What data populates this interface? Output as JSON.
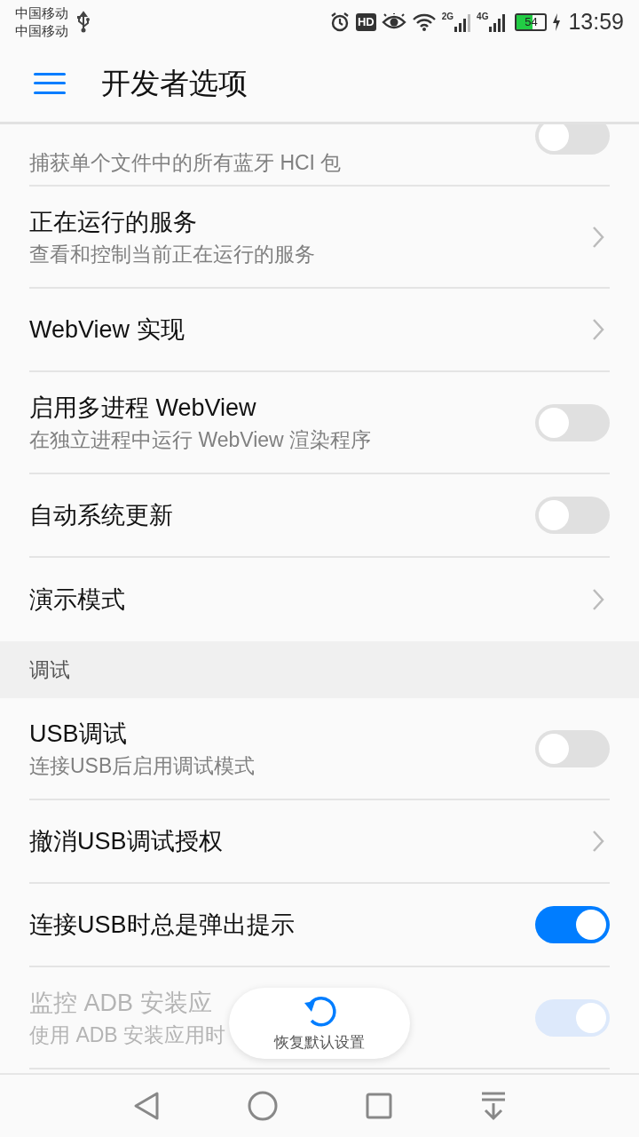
{
  "status_bar": {
    "carriers": [
      "中国移动",
      "中国移动"
    ],
    "hd": "HD",
    "network_2g": "2G",
    "network_4g": "4G",
    "battery": "54",
    "time": "13:59"
  },
  "header": {
    "title": "开发者选项"
  },
  "sections": [
    {
      "items": [
        {
          "kind": "toggle",
          "subtitle": "捕获单个文件中的所有蓝牙 HCI 包",
          "on": false,
          "disabled": false,
          "cut": true
        },
        {
          "kind": "link",
          "title": "正在运行的服务",
          "subtitle": "查看和控制当前正在运行的服务",
          "disabled": false
        },
        {
          "kind": "link",
          "title": "WebView 实现",
          "disabled": false
        },
        {
          "kind": "toggle",
          "title": "启用多进程 WebView",
          "subtitle": "在独立进程中运行 WebView 渲染程序",
          "on": false,
          "disabled": false
        },
        {
          "kind": "toggle",
          "title": "自动系统更新",
          "on": false,
          "disabled": false
        },
        {
          "kind": "link",
          "title": "演示模式",
          "disabled": false
        }
      ]
    },
    {
      "heading": "调试",
      "items": [
        {
          "kind": "toggle",
          "title": "USB调试",
          "subtitle": "连接USB后启用调试模式",
          "on": false,
          "disabled": false
        },
        {
          "kind": "link",
          "title": "撤消USB调试授权",
          "disabled": false
        },
        {
          "kind": "toggle",
          "title": "连接USB时总是弹出提示",
          "on": true,
          "disabled": false
        },
        {
          "kind": "toggle",
          "title": "监控 ADB 安装应",
          "subtitle": "使用 ADB 安装应用时",
          "on": true,
          "disabled": true
        }
      ]
    }
  ],
  "floating_button": {
    "label": "恢复默认设置"
  }
}
